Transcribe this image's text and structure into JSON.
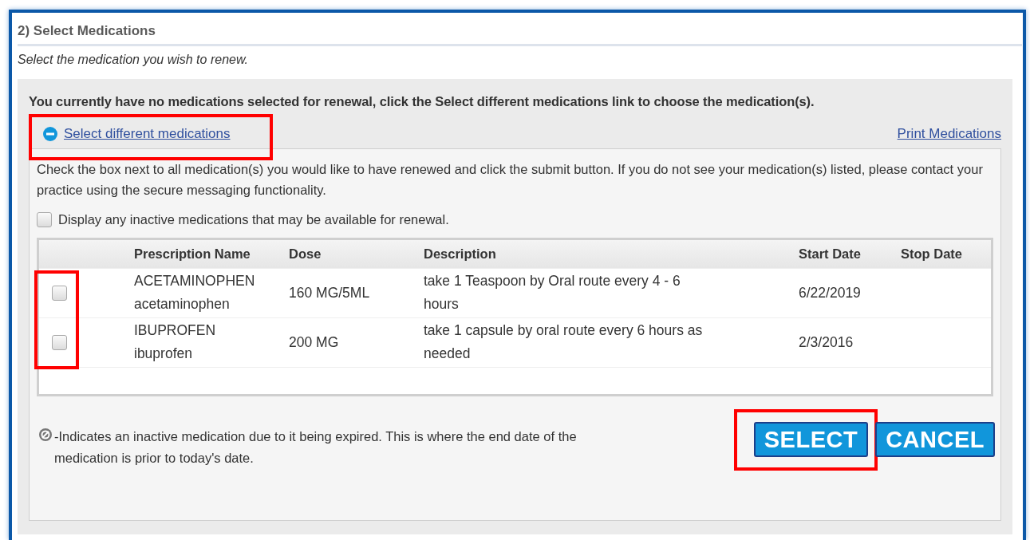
{
  "section": {
    "title": "2) Select Medications",
    "subtitle": "Select the medication you wish to renew."
  },
  "notice": "You currently have no medications selected for renewal, click the Select different medications link to choose the medication(s).",
  "select_link": {
    "label": "Select different medications",
    "highlighted": true
  },
  "print_link": "Print Medications",
  "help_text": "Check the box next to all medication(s) you would like to have renewed and click the submit button. If you do not see your medication(s) listed, please contact your practice using the secure messaging functionality.",
  "inactive_toggle": {
    "label": "Display any inactive medications that may be available for renewal.",
    "checked": false
  },
  "table": {
    "columns": [
      "Prescription Name",
      "Dose",
      "Description",
      "Start Date",
      "Stop Date"
    ],
    "checkboxes_highlighted": true,
    "rows": [
      {
        "checked": false,
        "name": "ACETAMINOPHEN",
        "generic": "acetaminophen",
        "dose": "160 MG/5ML",
        "description": "take 1 Teaspoon by Oral route every 4 - 6 hours",
        "start": "6/22/2019"
      },
      {
        "checked": false,
        "name": "IBUPROFEN",
        "generic": "ibuprofen",
        "dose": "200 MG",
        "description": "take 1 capsule by oral route every 6 hours as needed",
        "start": "2/3/2016"
      }
    ]
  },
  "legend": "-Indicates an inactive medication due to it being expired. This is where the end date of the medication is prior to today's date.",
  "buttons": [
    {
      "label": "SELECT",
      "highlighted": true
    },
    {
      "label": "CANCEL",
      "highlighted": false
    }
  ]
}
